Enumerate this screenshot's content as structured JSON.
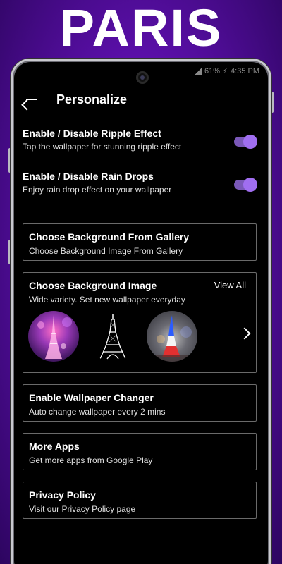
{
  "promo": {
    "title": "PARIS"
  },
  "status_bar": {
    "battery": "61%",
    "time": "4:35 PM"
  },
  "appbar": {
    "title": "Personalize"
  },
  "settings": {
    "ripple": {
      "title": "Enable / Disable Ripple Effect",
      "subtitle": "Tap the wallpaper for stunning ripple effect",
      "enabled": true
    },
    "rain": {
      "title": "Enable / Disable Rain Drops",
      "subtitle": "Enjoy rain drop effect on your wallpaper",
      "enabled": true
    }
  },
  "cards": {
    "gallery": {
      "title": "Choose Background From Gallery",
      "subtitle": "Choose Background Image From Gallery"
    },
    "background": {
      "title": "Choose Background Image",
      "subtitle": "Wide variety. Set new wallpaper everyday",
      "view_all": "View All"
    },
    "changer": {
      "title": "Enable Wallpaper Changer",
      "subtitle": "Auto change wallpaper every 2 mins"
    },
    "more_apps": {
      "title": "More Apps",
      "subtitle": "Get more apps from Google Play"
    },
    "privacy": {
      "title": "Privacy Policy",
      "subtitle": "Visit our Privacy Policy page"
    }
  },
  "colors": {
    "accent": "#a06ef0",
    "background_purple": "#6a1bc0"
  },
  "icons": [
    "back-arrow-icon",
    "camera-icon",
    "signal-icon",
    "battery-icon",
    "chevron-right-icon"
  ]
}
